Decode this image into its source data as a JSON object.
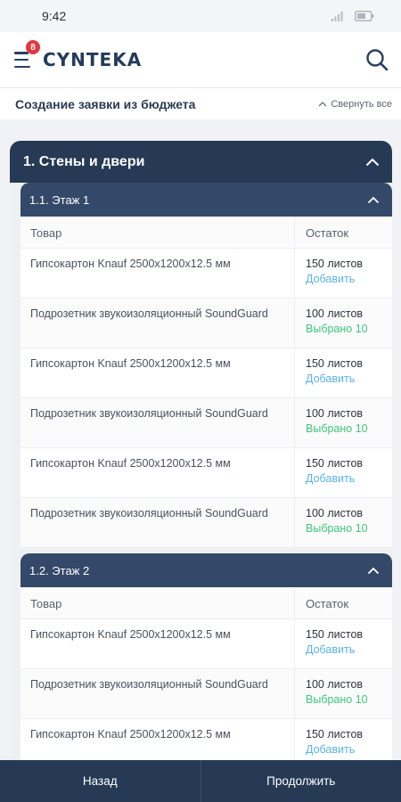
{
  "status": {
    "time": "9:42"
  },
  "appbar": {
    "badge_count": "8",
    "logo": "CYNTEKA"
  },
  "subheader": {
    "title": "Создание заявки из бюджета",
    "collapse_all": "Свернуть все"
  },
  "section": {
    "title": "1. Стены и двери",
    "floors": [
      {
        "title": "1.1. Этаж 1",
        "col_product": "Товар",
        "col_stock": "Остаток",
        "rows": [
          {
            "product": "Гипсокартон Knauf 2500х1200х12.5 мм",
            "stock": "150 листов",
            "action": "Добавить",
            "state": "add"
          },
          {
            "product": "Подрозетник звукоизоляционный SoundGuard",
            "stock": "100 листов",
            "action": "Выбрано 10",
            "state": "selected"
          },
          {
            "product": "Гипсокартон Knauf 2500х1200х12.5 мм",
            "stock": "150 листов",
            "action": "Добавить",
            "state": "add"
          },
          {
            "product": "Подрозетник звукоизоляционный SoundGuard",
            "stock": "100 листов",
            "action": "Выбрано 10",
            "state": "selected"
          },
          {
            "product": "Гипсокартон Knauf 2500х1200х12.5 мм",
            "stock": "150 листов",
            "action": "Добавить",
            "state": "add"
          },
          {
            "product": "Подрозетник звукоизоляционный SoundGuard",
            "stock": "100 листов",
            "action": "Выбрано 10",
            "state": "selected"
          }
        ]
      },
      {
        "title": "1.2. Этаж 2",
        "col_product": "Товар",
        "col_stock": "Остаток",
        "rows": [
          {
            "product": "Гипсокартон Knauf 2500х1200х12.5 мм",
            "stock": "150 листов",
            "action": "Добавить",
            "state": "add"
          },
          {
            "product": "Подрозетник звукоизоляционный SoundGuard",
            "stock": "100 листов",
            "action": "Выбрано 10",
            "state": "selected"
          },
          {
            "product": "Гипсокартон Knauf 2500х1200х12.5 мм",
            "stock": "150 листов",
            "action": "Добавить",
            "state": "add"
          }
        ]
      }
    ]
  },
  "bottom": {
    "back_label": "Назад",
    "continue_label": "Продолжить"
  },
  "colors": {
    "primary": "#263a55",
    "header_secondary": "#34496a",
    "add": "#5bb3e8",
    "selected": "#3fc77b",
    "badge": "#e3373f"
  },
  "icons": {
    "menu": "hamburger-icon",
    "search": "search-icon",
    "collapse": "chevron-up-icon",
    "signal": "signal-icon",
    "battery": "battery-icon"
  }
}
